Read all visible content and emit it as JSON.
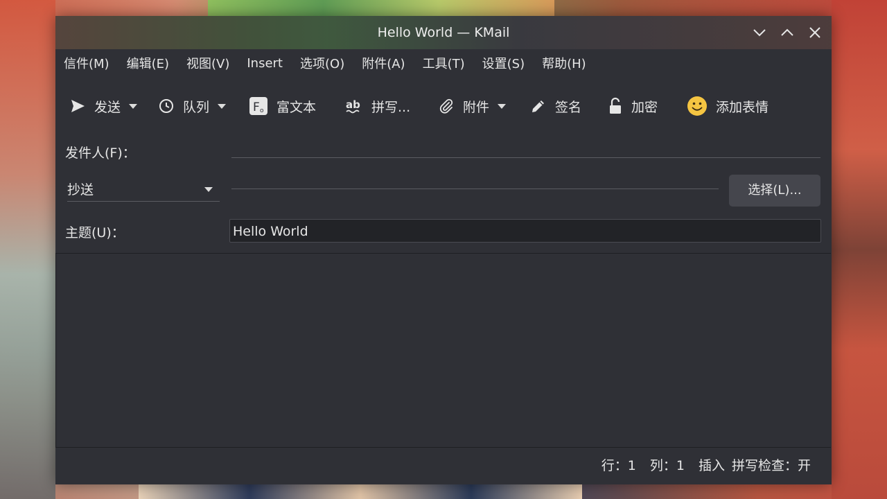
{
  "window": {
    "title": "Hello World — KMail"
  },
  "menubar": [
    {
      "label": "信件(M)"
    },
    {
      "label": "编辑(E)"
    },
    {
      "label": "视图(V)"
    },
    {
      "label": "Insert"
    },
    {
      "label": "选项(O)"
    },
    {
      "label": "附件(A)"
    },
    {
      "label": "工具(T)"
    },
    {
      "label": "设置(S)"
    },
    {
      "label": "帮助(H)"
    }
  ],
  "toolbar": {
    "send": {
      "label": "发送",
      "icon": "send-icon"
    },
    "queue": {
      "label": "队列",
      "icon": "clock-icon"
    },
    "rich_text": {
      "label": "富文本",
      "icon": "rich-text-icon"
    },
    "spellcheck": {
      "label": "拼写...",
      "icon": "spellcheck-icon"
    },
    "attach": {
      "label": "附件",
      "icon": "paperclip-icon"
    },
    "signature": {
      "label": "签名",
      "icon": "pencil-icon"
    },
    "encrypt": {
      "label": "加密",
      "icon": "lock-icon"
    },
    "emoticon": {
      "label": "添加表情",
      "icon": "smiley-icon"
    }
  },
  "fields": {
    "from_label": "发件人(F)：",
    "from_value": "",
    "recipient_type": "抄送",
    "recipient_value": "",
    "select_button": "选择(L)...",
    "subject_label": "主题(U)：",
    "subject_value": "Hello World"
  },
  "statusbar": {
    "line": "行：1",
    "column": "列：1",
    "mode": "插入",
    "spellcheck": "拼写检查：开"
  },
  "colors": {
    "window_bg": "#2f3036",
    "text": "#e6e6e6",
    "input_bg": "#222327",
    "button_bg": "#45464d",
    "emoji_yellow": "#f5c542"
  }
}
